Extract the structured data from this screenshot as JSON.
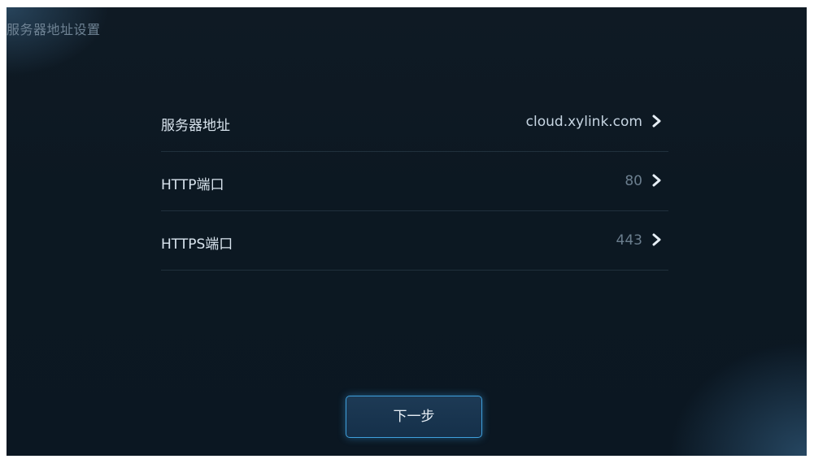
{
  "header": {
    "title": "服务器地址设置"
  },
  "settings": [
    {
      "label": "服务器地址",
      "value": "cloud.xylink.com",
      "icon": "chevron-right-icon"
    },
    {
      "label": "HTTP端口",
      "value": "80",
      "icon": "chevron-right-icon"
    },
    {
      "label": "HTTPS端口",
      "value": "443",
      "icon": "chevron-right-icon"
    }
  ],
  "actions": {
    "next_label": "下一步"
  },
  "colors": {
    "background": "#0c1822",
    "accent": "#3fa0dc",
    "text_primary": "#d9e4ee",
    "text_muted": "#6b7e8e"
  }
}
